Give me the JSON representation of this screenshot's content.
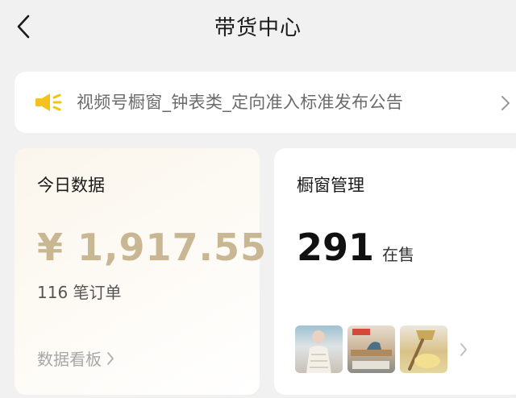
{
  "header": {
    "title": "带货中心"
  },
  "notice": {
    "text": "视频号橱窗_钟表类_定向准入标准发布公告"
  },
  "today": {
    "title": "今日数据",
    "amount": "¥ 1,917.55",
    "orders": "116 笔订单",
    "board_link": "数据看板"
  },
  "window": {
    "title": "橱窗管理",
    "count": "291",
    "count_unit": "在售"
  },
  "icons": {
    "back": "chevron-left-icon",
    "speaker": "megaphone-icon",
    "arrow": "chevron-right-icon"
  },
  "colors": {
    "accent_gold": "#c8b792",
    "speaker_yellow": "#f5c21b",
    "background": "#f1f1f1"
  }
}
